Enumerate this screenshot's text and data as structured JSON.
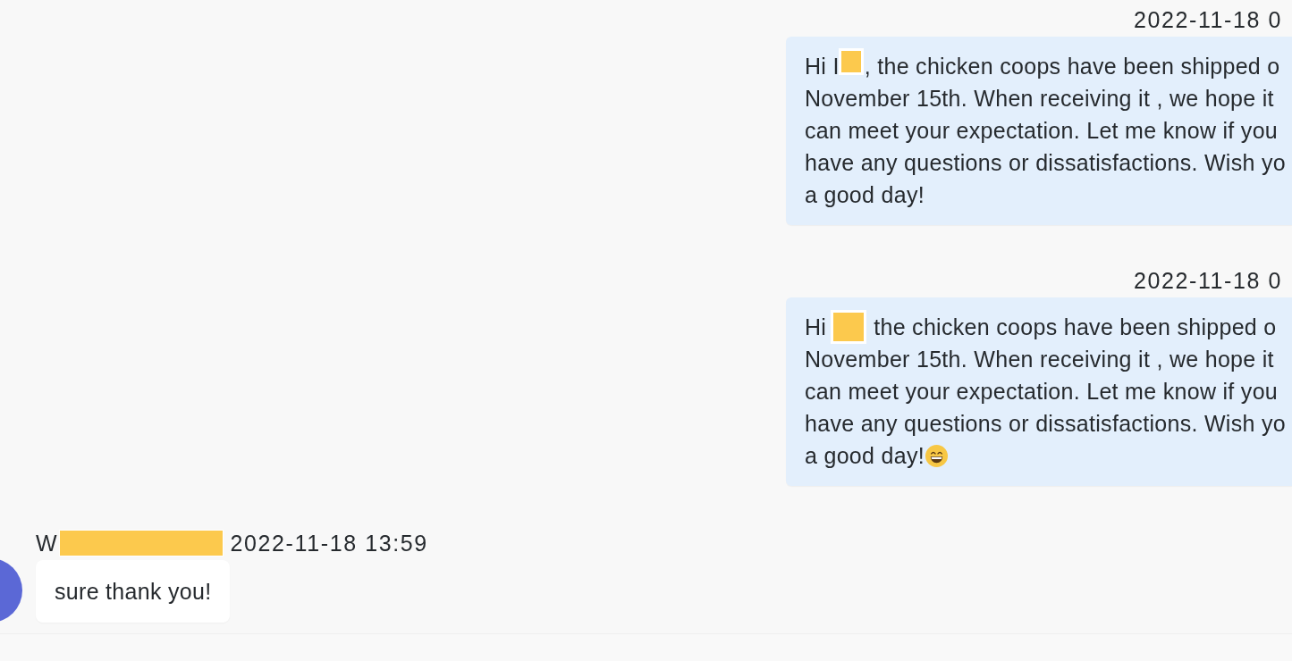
{
  "messages": [
    {
      "kind": "outgoing",
      "timestamp": "2022-11-18 0",
      "text_before_redaction": "Hi I",
      "text_after_redaction": ", the chicken coops have been shipped o",
      "lines": [
        "November 15th. When receiving it , we hope it",
        "can meet your expectation. Let me know if you",
        "have any questions or dissatisfactions. Wish yo",
        "a good day!"
      ],
      "ends_with_emoji": false
    },
    {
      "kind": "outgoing",
      "timestamp": "2022-11-18 0",
      "text_before_redaction": "Hi",
      "text_after_redaction": "the chicken coops have been shipped o",
      "lines": [
        "November 15th. When receiving it , we hope it",
        "can meet your expectation. Let me know if you",
        "have any questions or dissatisfactions. Wish yo",
        "a good day!"
      ],
      "ends_with_emoji": true
    },
    {
      "kind": "incoming",
      "sender": "W",
      "timestamp": "2022-11-18 13:59",
      "text": "sure thank you!"
    }
  ]
}
